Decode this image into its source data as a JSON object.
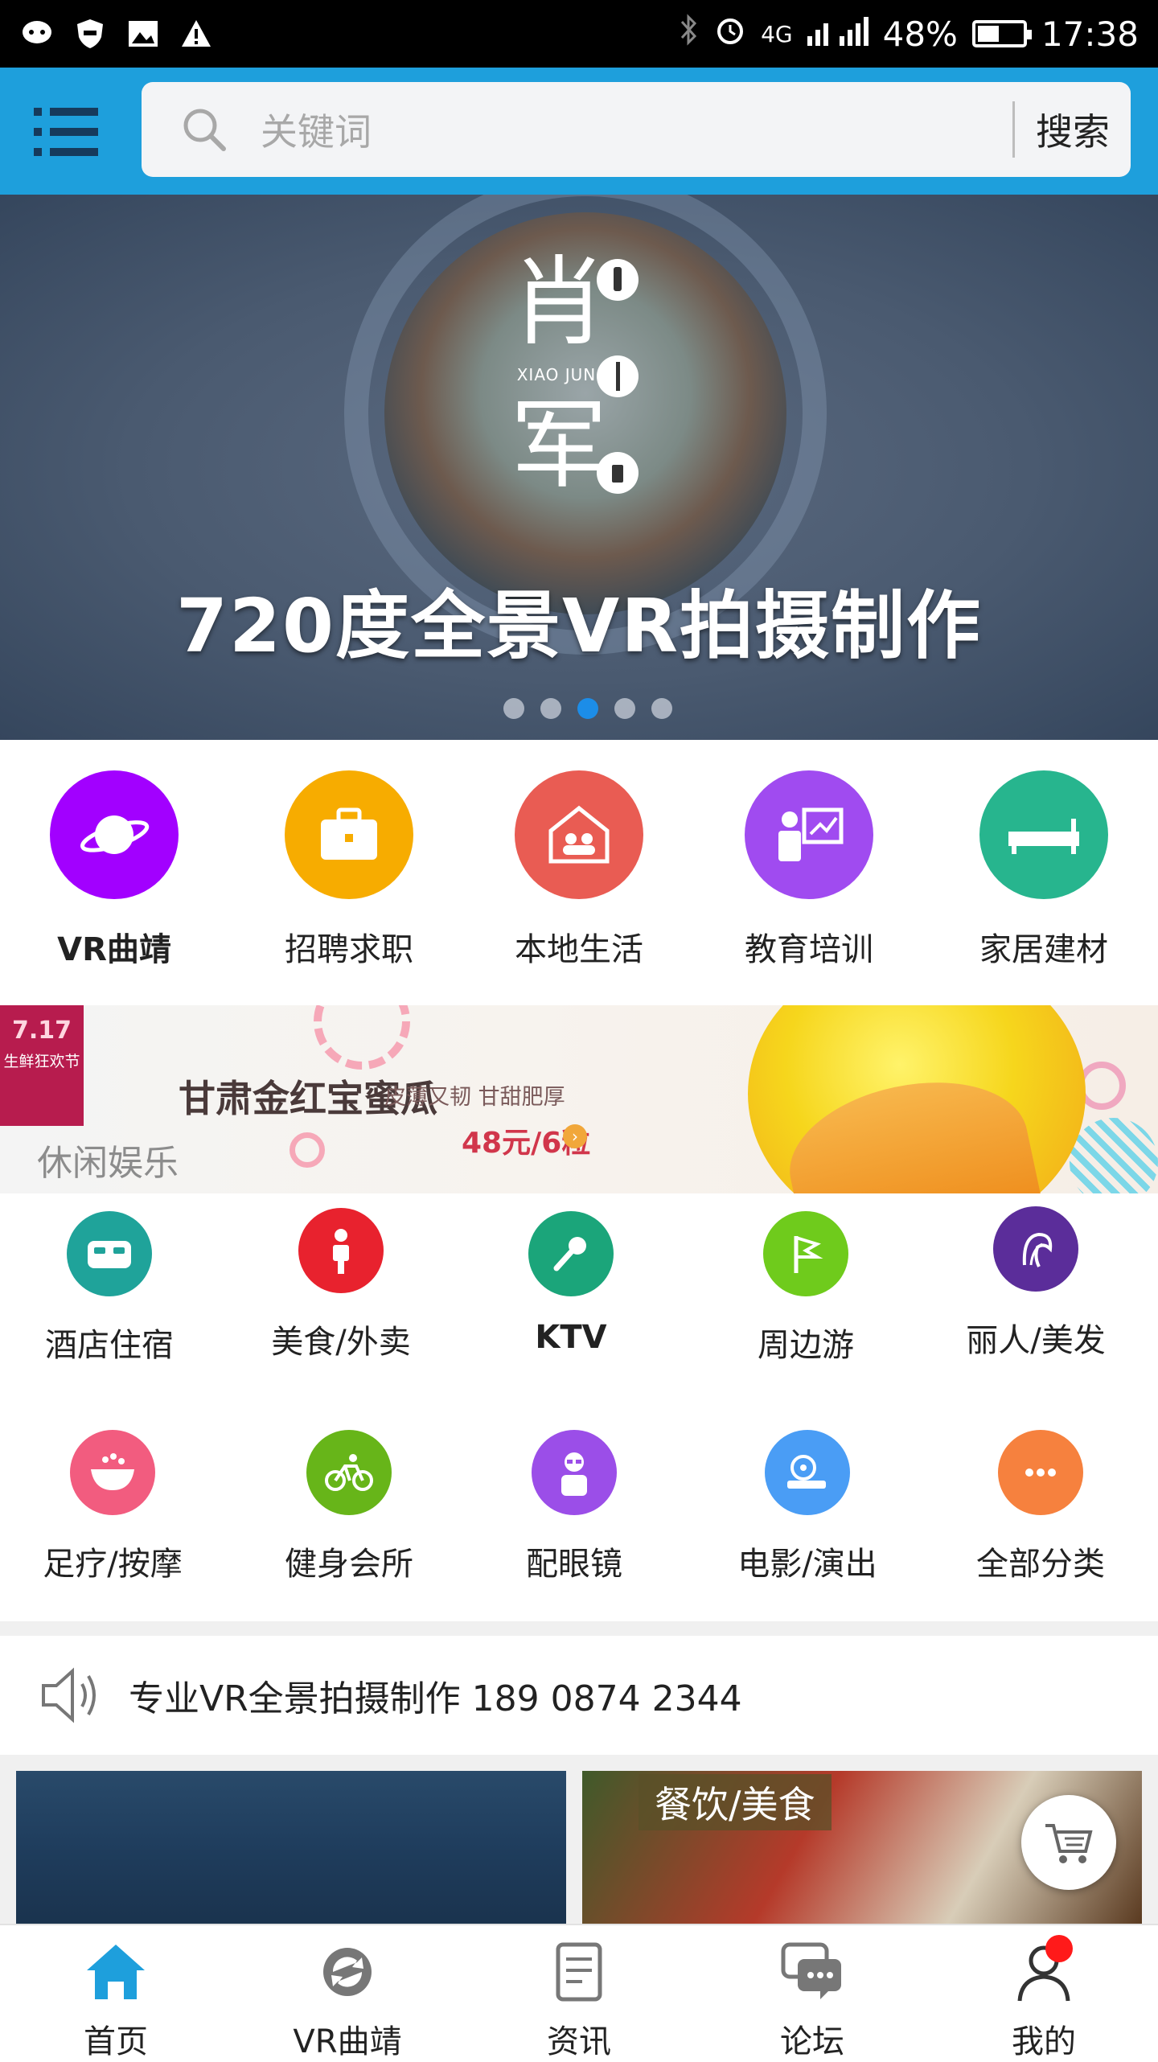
{
  "status_bar": {
    "network": "4G",
    "battery": "48%",
    "battery_level": 0.48,
    "time": "17:38"
  },
  "search": {
    "placeholder": "关键词",
    "button_label": "搜索"
  },
  "banner": {
    "vertical_title": "肖军",
    "vertical_subtitle": "XIAO JUN",
    "caption": "720度全景VR拍摄制作",
    "page_count": 5,
    "active_page": 3
  },
  "categories": [
    {
      "label": "VR曲靖",
      "icon": "planet-icon",
      "color": "#a200ff"
    },
    {
      "label": "招聘求职",
      "icon": "briefcase-icon",
      "color": "#f7ac00"
    },
    {
      "label": "本地生活",
      "icon": "house-people-icon",
      "color": "#e95c53"
    },
    {
      "label": "教育培训",
      "icon": "teacher-board-icon",
      "color": "#a04bf0"
    },
    {
      "label": "家居建材",
      "icon": "bed-icon",
      "color": "#27b58e"
    }
  ],
  "promo": {
    "tag_line1": "7.17",
    "tag_line2": "生鲜狂欢节",
    "title": "甘肃金红宝蜜瓜",
    "subtitle": "皮薄又韧 甘甜肥厚",
    "price": "48元/6粒",
    "section_label": "休闲娱乐"
  },
  "services": [
    {
      "label": "酒店住宿",
      "icon": "hotel-bed-icon",
      "color": "#1fa39a"
    },
    {
      "label": "美食/外卖",
      "icon": "delivery-person-icon",
      "color": "#e8222e"
    },
    {
      "label": "KTV",
      "icon": "microphone-icon",
      "color": "#1ba57a"
    },
    {
      "label": "周边游",
      "icon": "flag-icon",
      "color": "#6fcb1c"
    },
    {
      "label": "丽人/美发",
      "icon": "hair-icon",
      "color": "#5b2d9a"
    },
    {
      "label": "足疗/按摩",
      "icon": "foot-bath-icon",
      "color": "#f25c7f"
    },
    {
      "label": "健身会所",
      "icon": "bicycle-icon",
      "color": "#67b519"
    },
    {
      "label": "配眼镜",
      "icon": "glasses-person-icon",
      "color": "#9b4ee8"
    },
    {
      "label": "电影/演出",
      "icon": "film-reel-icon",
      "color": "#4a9df5"
    },
    {
      "label": "全部分类",
      "icon": "more-dots-icon",
      "color": "#f6813e"
    }
  ],
  "notice": {
    "text": "专业VR全景拍摄制作 189 0874 2344"
  },
  "cards": {
    "right_label": "餐饮/美食"
  },
  "tabs": [
    {
      "label": "首页",
      "icon": "home-icon"
    },
    {
      "label": "VR曲靖",
      "icon": "vr-icon"
    },
    {
      "label": "资讯",
      "icon": "news-icon"
    },
    {
      "label": "论坛",
      "icon": "forum-icon"
    },
    {
      "label": "我的",
      "icon": "user-icon"
    }
  ],
  "colors": {
    "header": "#1e9fdc",
    "active_tab": "#1e9fdc",
    "active_dot": "#1c8de8"
  }
}
